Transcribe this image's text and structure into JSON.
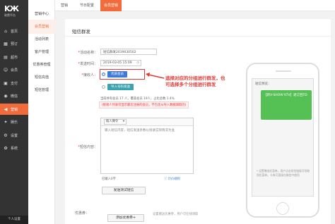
{
  "sidebar": {
    "logo_mark": "KЖ",
    "logo_sub": "致赞平台",
    "items": [
      {
        "label": "首页",
        "icon": "home-icon",
        "glyph": "⌂"
      },
      {
        "label": "预订",
        "icon": "calendar-icon",
        "glyph": "▦"
      },
      {
        "label": "超市",
        "icon": "shop-icon",
        "glyph": "▤"
      },
      {
        "label": "会员",
        "icon": "user-icon",
        "glyph": "☺"
      },
      {
        "label": "支付",
        "icon": "payment-icon",
        "glyph": "▣"
      },
      {
        "label": "微信",
        "icon": "wechat-icon",
        "glyph": "◉"
      },
      {
        "label": "营销",
        "icon": "megaphone-icon",
        "glyph": "◀"
      },
      {
        "label": "娱乐",
        "icon": "game-icon",
        "glyph": "✦"
      },
      {
        "label": "设置",
        "icon": "gear-icon",
        "glyph": "⚙"
      },
      {
        "label": "系统",
        "icon": "system-icon",
        "glyph": "✿"
      }
    ],
    "active_index": 6,
    "bottom_user": "个人设置"
  },
  "subnav": {
    "items": [
      "营销中心",
      "会员营销",
      "活动列表",
      "客户管理",
      "优惠券管理",
      "短信充值",
      "短信管理"
    ],
    "active_index": 1
  },
  "tabs": [
    "营销",
    "节日配置",
    "会员营销"
  ],
  "active_tab": 2,
  "page": {
    "title": "短信群发",
    "activity_name_label": "活动名称：",
    "activity_name_value": "短信群发2019030502",
    "send_time_label": "发送时间：",
    "send_time_value": "2019-03-05 15:09",
    "receiver_label": "接收人：",
    "receiver_option_1": "优质会员",
    "receiver_option_2": "导入号码发送",
    "annotation": "选择对应的分组进行群发，也\n可选择多个分组进行群发",
    "stats_line": "当前共有会员 17 人，覆盖会员 19人，占比总数 1.4%",
    "warning_line": "(接收人列表仅显示最近注册的会员，不包含从导入数据调取的)",
    "content_label": "短信内容：",
    "insert_var": "插入微令",
    "editor_placeholder": "输入短信内容，短信发送条数以接收实际情况为准",
    "char_count": "已输入0字",
    "charge_link": "计价规则",
    "test_button": "发送测试短信",
    "coupon_label": "优惠券：",
    "add_coupon_button": "添加优惠券+",
    "coupon_note": "设置赠送优惠券，用户可在线领取"
  },
  "phone": {
    "preview_label": "短信预览：",
    "bubble_text": "【新V-SHOW KTV】退订回TD",
    "note": "* 设置赠送优惠券，用户点击短信链接可领取到优惠券，卡券可直接在微信中使用"
  },
  "colors": {
    "accent": "#f26b3a",
    "sidebar_bg": "#333333",
    "annotation_red": "#e53935",
    "bubble_green": "#55c155",
    "radio_blue": "#3b7bd8"
  }
}
